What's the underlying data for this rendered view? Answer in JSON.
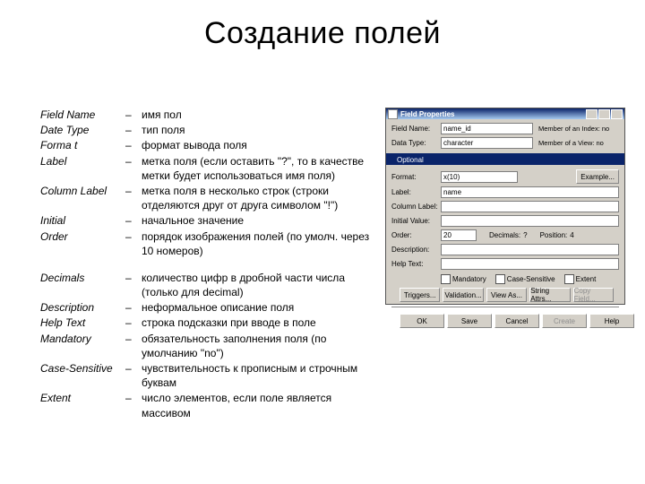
{
  "title": "Создание полей",
  "rows": [
    {
      "label": "Field Name",
      "desc": "имя пол"
    },
    {
      "label": "Date Type",
      "desc": "тип поля"
    },
    {
      "label": "Forma  t",
      "desc": "формат вывода поля"
    },
    {
      "label": "Label",
      "desc": "метка поля (если оставить \"?\", то в качестве метки будет  использоваться имя поля)"
    },
    {
      "label": "Column Label",
      "desc": "метка поля в несколько строк (строки отделяются друг от друга символом \"!\")"
    },
    {
      "label": "Initial",
      "desc": "начальное значение"
    },
    {
      "label": "Order",
      "desc": "порядок изображения полей (по умолч. через 10 номеров)"
    },
    {
      "label": "",
      "desc": ""
    },
    {
      "label": "Decimals",
      "desc": "количество цифр в дробной части числа (только для decimal)"
    },
    {
      "label": "Description",
      "desc": "неформальное описание поля"
    },
    {
      "label": "Help Text",
      "desc": "строка подсказки при вводе в поле"
    },
    {
      "label": "Mandatory",
      "desc": "обязательность заполнения поля (по умолчанию \"no\")"
    },
    {
      "label": "Case-Sensitive",
      "desc": "чувствительность к прописным и строчным буквам"
    },
    {
      "label": "Extent",
      "desc": "число элементов, если поле является массивом"
    }
  ],
  "dialog": {
    "title": "Field Properties",
    "field_name_label": "Field Name:",
    "field_name_value": "name_id",
    "data_type_label": "Data Type:",
    "data_type_value": "character",
    "side1": "Member of an Index: no",
    "side2": "Member of a View: no",
    "tab": "Optional",
    "format_label": "Format:",
    "format_value": "x(10)",
    "label_label": "Label:",
    "label_value": "name",
    "col_label_label": "Column Label:",
    "col_label_value": "",
    "initial_label": "Initial Value:",
    "initial_value": "",
    "order_label": "Order:",
    "order_value": "20",
    "decimals_label": "Decimals:",
    "decimals_value": "?",
    "position_label": "Position:",
    "position_value": "4",
    "description_label": "Description:",
    "help_label": "Help Text:",
    "mandatory": "Mandatory",
    "case_sensitive": "Case-Sensitive",
    "extent": "Extent",
    "example_btn": "Example...",
    "buttons_mid": [
      "Triggers...",
      "Validation...",
      "View As...",
      "String Attrs...",
      "Copy Field..."
    ],
    "buttons_bot": [
      "OK",
      "Save",
      "Cancel",
      "Create",
      "Help"
    ]
  }
}
